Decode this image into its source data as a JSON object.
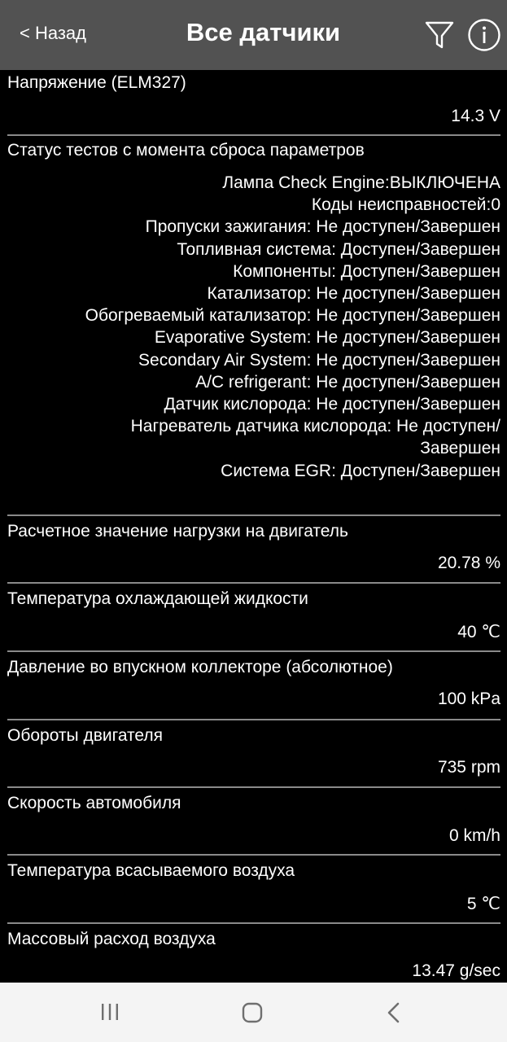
{
  "header": {
    "back_label": "< Назад",
    "title": "Все датчики",
    "icons": [
      "filter-icon",
      "info-icon"
    ]
  },
  "sensors": [
    {
      "label": "Напряжение (ELM327)",
      "value": "14.3 V"
    },
    {
      "label": "Расчетное значение нагрузки на двигатель",
      "value": "20.78 %"
    },
    {
      "label": "Температура охлаждающей жидкости",
      "value": "40 ℃"
    },
    {
      "label": "Давление во впускном коллекторе (абсолютное)",
      "value": "100 kPa"
    },
    {
      "label": "Обороты двигателя",
      "value": "735 rpm"
    },
    {
      "label": "Скорость автомобиля",
      "value": "0 km/h"
    },
    {
      "label": "Температура всасываемого воздуха",
      "value": "5 ℃"
    },
    {
      "label": "Массовый расход воздуха",
      "value": "13.47 g/sec"
    }
  ],
  "status": {
    "label": "Статус тестов с момента сброса параметров",
    "lines": [
      "Лампа Check Engine:ВЫКЛЮЧЕНА",
      "Коды неисправностей:0",
      "Пропуски зажигания: Не доступен/Завершен",
      "Топливная система: Доступен/Завершен",
      "Компоненты: Доступен/Завершен",
      "Катализатор: Не доступен/Завершен",
      "Обогреваемый катализатор: Не доступен/Завершен",
      "Evaporative System: Не доступен/Завершен",
      "Secondary Air System: Не доступен/Завершен",
      "A/C refrigerant: Не доступен/Завершен",
      "Датчик кислорода: Не доступен/Завершен",
      "Нагреватель датчика кислорода: Не доступен/",
      "Завершен",
      "Система EGR: Доступен/Завершен"
    ]
  },
  "navbar": {
    "icons": [
      "recents-icon",
      "home-icon",
      "back-icon"
    ]
  }
}
